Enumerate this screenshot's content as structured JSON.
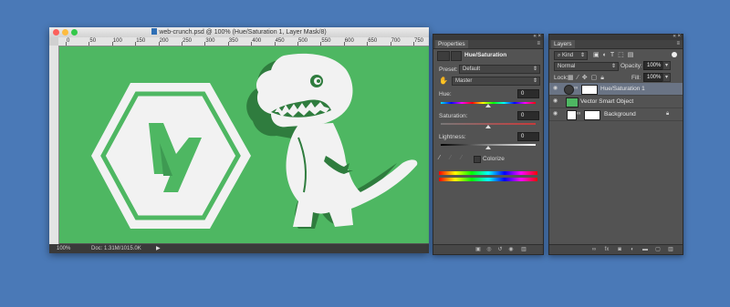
{
  "document": {
    "title": "web-crunch.psd @ 100% (Hue/Saturation 1, Layer Mask/8)",
    "ruler_ticks": [
      "0",
      "50",
      "100",
      "150",
      "200",
      "250",
      "300",
      "350",
      "400",
      "450",
      "500",
      "550",
      "600",
      "650",
      "700",
      "750"
    ],
    "zoom": "100%",
    "doc_info": "Doc: 1.31M/1015.0K"
  },
  "properties": {
    "tab": "Properties",
    "adjustment_name": "Hue/Saturation",
    "preset_label": "Preset:",
    "preset_value": "Default",
    "channel_value": "Master",
    "hue_label": "Hue:",
    "hue_value": "0",
    "saturation_label": "Saturation:",
    "saturation_value": "0",
    "lightness_label": "Lightness:",
    "lightness_value": "0",
    "colorize_label": "Colorize",
    "colorize_checked": false
  },
  "layers": {
    "tab": "Layers",
    "filter_label": "Kind",
    "blend_mode": "Normal",
    "opacity_label": "Opacity:",
    "opacity_value": "100%",
    "lock_label": "Lock:",
    "fill_label": "Fill:",
    "fill_value": "100%",
    "items": [
      {
        "name": "Hue/Saturation 1",
        "selected": true
      },
      {
        "name": "Vector Smart Object",
        "selected": false
      },
      {
        "name": "Background",
        "selected": false,
        "locked": true
      }
    ]
  },
  "colors": {
    "desktop": "#4a79b7",
    "panel_bg": "#535353",
    "canvas_green": "#4eb762",
    "artwork_white": "#f2f2f2"
  }
}
